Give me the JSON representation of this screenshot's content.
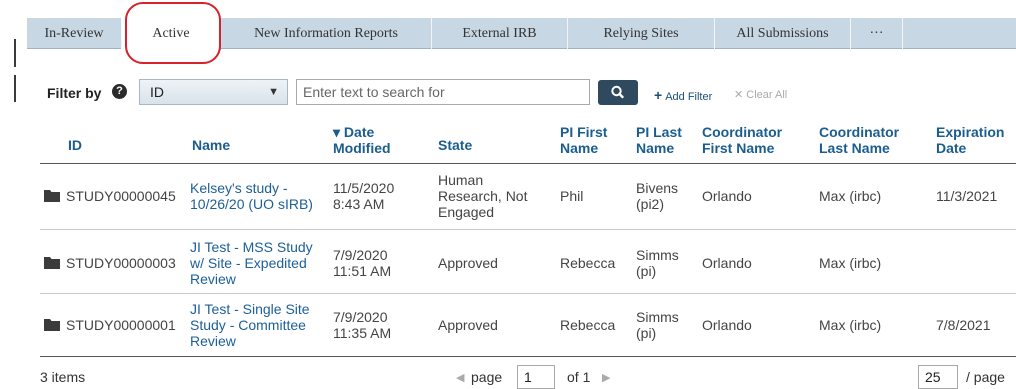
{
  "tabs": [
    {
      "label": "In-Review"
    },
    {
      "label": "Active"
    },
    {
      "label": "New Information Reports"
    },
    {
      "label": "External IRB"
    },
    {
      "label": "Relying Sites"
    },
    {
      "label": "All Submissions"
    },
    {
      "label": "···"
    }
  ],
  "active_tab": "Active",
  "filter": {
    "label": "Filter by",
    "help": "?",
    "field": "ID",
    "search_placeholder": "Enter text to search for",
    "add_filter": "Add Filter",
    "clear_all": "Clear All"
  },
  "columns": [
    {
      "label": "ID"
    },
    {
      "label": "Name"
    },
    {
      "label": "▾ Date Modified"
    },
    {
      "label": "State"
    },
    {
      "label": "PI First Name"
    },
    {
      "label": "PI Last Name"
    },
    {
      "label": "Coordinator First Name"
    },
    {
      "label": "Coordinator Last Name"
    },
    {
      "label": "Expiration Date"
    }
  ],
  "rows": [
    {
      "id": "STUDY00000045",
      "name": "Kelsey's study - 10/26/20 (UO sIRB)",
      "date_modified": "11/5/2020 8:43 AM",
      "state": "Human Research, Not Engaged",
      "pi_first": "Phil",
      "pi_last": "Bivens (pi2)",
      "coord_first": "Orlando",
      "coord_last": "Max (irbc)",
      "expiration": "11/3/2021"
    },
    {
      "id": "STUDY00000003",
      "name": "JI Test - MSS Study w/ Site - Expedited Review",
      "date_modified": "7/9/2020 11:51 AM",
      "state": "Approved",
      "pi_first": "Rebecca",
      "pi_last": "Simms (pi)",
      "coord_first": "Orlando",
      "coord_last": "Max (irbc)",
      "expiration": ""
    },
    {
      "id": "STUDY00000001",
      "name": "JI Test - Single Site Study - Committee Review",
      "date_modified": "7/9/2020 11:35 AM",
      "state": "Approved",
      "pi_first": "Rebecca",
      "pi_last": "Simms (pi)",
      "coord_first": "Orlando",
      "coord_last": "Max (irbc)",
      "expiration": "7/8/2021"
    }
  ],
  "footer": {
    "items": "3 items",
    "page_label": "page",
    "page_value": "1",
    "of_label": "of 1",
    "per_page_value": "25",
    "per_page_label": "/ page"
  }
}
